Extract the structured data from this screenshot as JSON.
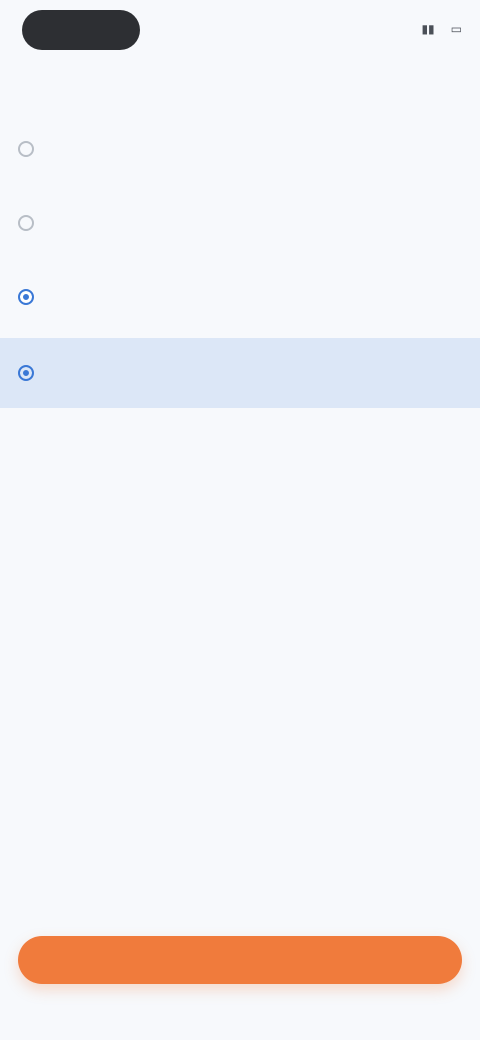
{
  "status_bar": {
    "pill_text": "",
    "right_text": ""
  },
  "tabs": [
    {
      "label": ""
    },
    {
      "label": ""
    }
  ],
  "list": {
    "rows": [
      {
        "label": "",
        "meta": ""
      },
      {
        "label": "",
        "meta": ""
      },
      {
        "label": "",
        "meta": ""
      },
      {
        "label": "",
        "meta": ""
      }
    ],
    "more_link": ""
  },
  "cta": {
    "label": ""
  },
  "colors": {
    "background": "#f7f9fc",
    "selected_row": "#dce7f7",
    "accent_blue": "#3a78d6",
    "cta_orange": "#f07b3c"
  },
  "icons": {
    "signal": "signal-icon",
    "battery": "battery-icon"
  }
}
